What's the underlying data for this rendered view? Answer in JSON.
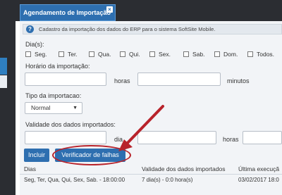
{
  "tab": {
    "title": "Agendamento de Importação",
    "close_icon": "close-icon"
  },
  "info": {
    "icon": "question-icon",
    "text": "Cadastro da importação dos dados do ERP para o sistema SoftSite Mobile."
  },
  "form": {
    "dias_label": "Dia(s):",
    "days": [
      "Seg.",
      "Ter.",
      "Qua.",
      "Qui.",
      "Sex.",
      "Sab.",
      "Dom.",
      "Todos."
    ],
    "horario_label": "Horário da importação:",
    "horas_label": "horas",
    "minutos_label": "minutos",
    "hora_value": "",
    "minutos_value": "",
    "tipo_label": "Tipo da importacao:",
    "tipo_selected": "Normal",
    "validade_label": "Validade dos dados importados:",
    "dias_unit_label": "dia",
    "horas_unit_label": "horas",
    "validade_dias_value": "",
    "validade_horas_value": ""
  },
  "buttons": {
    "incluir": "Incluir",
    "verificador": "Verificador de falhas"
  },
  "annotation": {
    "highlight_color": "#b8232b"
  },
  "table": {
    "headers": [
      "Dias",
      "Validade dos dados importados",
      "Última execuçã"
    ],
    "rows": [
      [
        "Seg, Ter, Qua, Qui, Sex, Sab. - 18:00:00",
        "7 dia(s) - 0:0 hora(s)",
        "03/02/2017 18:0"
      ]
    ]
  },
  "colors": {
    "accent": "#2e6fb0",
    "sidebar": "#2b2d32",
    "panel": "#f2f4f7"
  }
}
